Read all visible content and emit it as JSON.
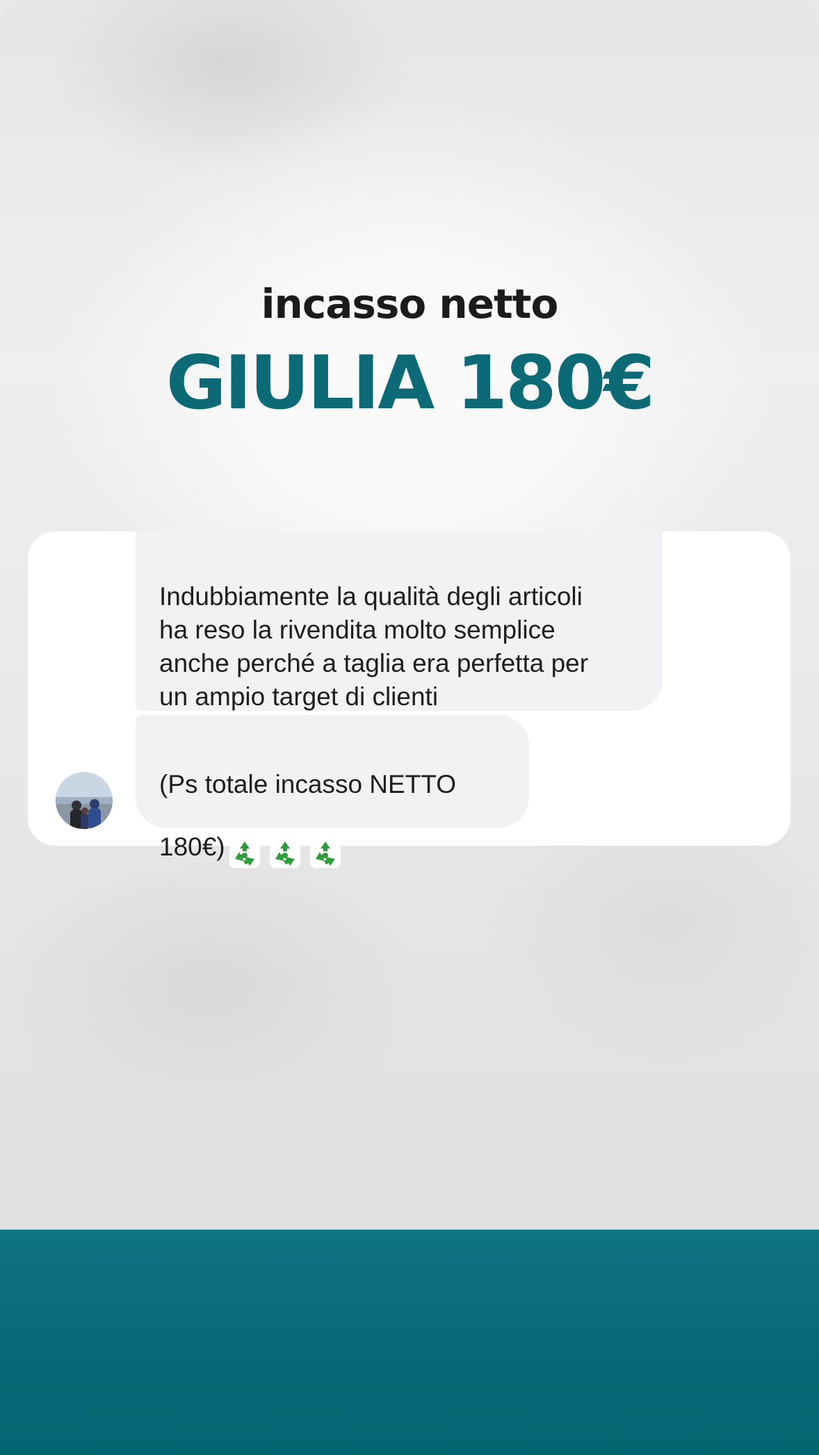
{
  "story": {
    "heading_small": "incasso netto",
    "heading_big": "GIULIA 180€"
  },
  "chat": {
    "messages": [
      {
        "text": "Indubbiamente la qualità degli articoli\nha reso la rivendita molto semplice\nanche perché a taglia era perfetta per\nun ampio target di clienti"
      },
      {
        "text": "(Ps totale incasso NETTO\n180€)",
        "emoji": [
          "recycle-icon",
          "recycle-icon",
          "recycle-icon"
        ]
      }
    ],
    "avatar": "profile-photo"
  },
  "colors": {
    "accent": "#0b6a76",
    "band": "#086a77",
    "bubble": "#f2f2f5",
    "recycle_green": "#2e9c3a"
  }
}
